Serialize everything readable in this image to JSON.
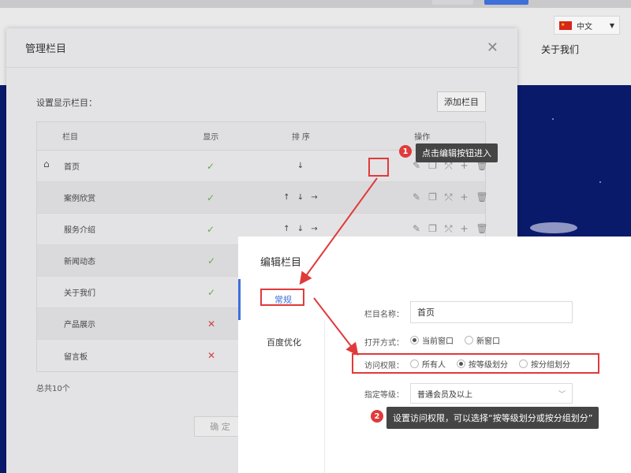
{
  "background": {
    "lang_label": "中文",
    "nav_about": "关于我们",
    "colors": {
      "hero_blue": "#0a1a6b",
      "accent_red": "#e03a3a",
      "link_blue": "#3f6fd8"
    }
  },
  "dialog": {
    "title": "管理栏目",
    "set_label": "设置显示栏目：",
    "add_button": "添加栏目",
    "columns": {
      "name": "栏目",
      "show": "显示",
      "sort": "排序",
      "actions": "操作"
    },
    "rows": [
      {
        "name": "首页",
        "show": "✓",
        "sort": "↓",
        "home": true
      },
      {
        "name": "案例欣赏",
        "show": "✓",
        "sort": "↑ ↓ →"
      },
      {
        "name": "服务介绍",
        "show": "✓",
        "sort": "↑ ↓ →"
      },
      {
        "name": "新闻动态",
        "show": "✓",
        "sort": ""
      },
      {
        "name": "关于我们",
        "show": "✓",
        "sort": ""
      },
      {
        "name": "产品展示",
        "show": "✕",
        "sort": ""
      },
      {
        "name": "留言板",
        "show": "✕",
        "sort": ""
      }
    ],
    "total": "总共10个",
    "confirm": "确 定"
  },
  "annotations": {
    "step1_num": "1",
    "step1_text": "点击编辑按钮进入",
    "step2_num": "2",
    "step2_text": "设置访问权限，可以选择“按等级划分或按分组划分”"
  },
  "edit_panel": {
    "title": "编辑栏目",
    "tabs": [
      "常规",
      "百度优化"
    ],
    "name_label": "栏目名称：",
    "name_value": "首页",
    "open_label": "打开方式：",
    "open_options": [
      "当前窗口",
      "新窗口"
    ],
    "access_label": "访问权限：",
    "access_options": [
      "所有人",
      "按等级划分",
      "按分组划分"
    ],
    "level_label": "指定等级：",
    "level_value": "普通会员及以上"
  }
}
